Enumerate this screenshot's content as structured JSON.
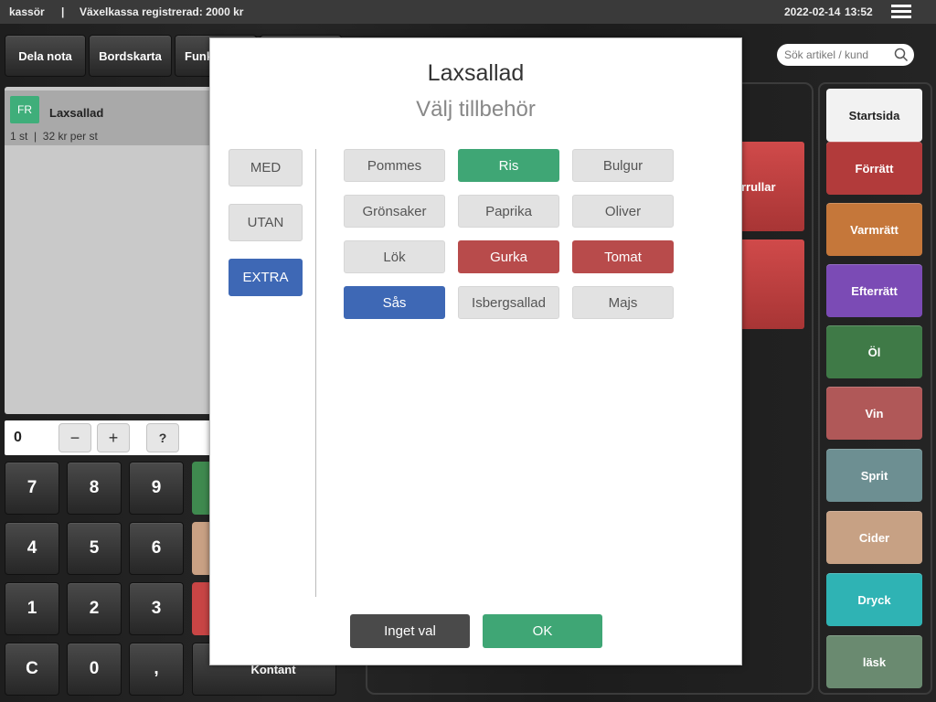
{
  "topbar": {
    "user": "kassör",
    "separator": "|",
    "cash_register": "Växelkassa registrerad:  2000 kr",
    "date": "2022-02-14",
    "time": "13:52"
  },
  "toolbar": {
    "split_bill": "Dela nota",
    "table_map": "Bordskarta",
    "functions": "Funk"
  },
  "search": {
    "placeholder": "Sök artikel / kund"
  },
  "order": {
    "items": [
      {
        "badge": "FR",
        "name": "Laxsallad",
        "detail": "1 st  |  32 kr per st"
      }
    ]
  },
  "qty": {
    "value": "0",
    "minus": "−",
    "plus": "+",
    "help": "?"
  },
  "numpad": {
    "keys": [
      "7",
      "8",
      "9",
      "4",
      "5",
      "6",
      "1",
      "2",
      "3",
      "C",
      "0",
      ","
    ],
    "cash": "Kontant"
  },
  "products": {
    "partial": "rrullar"
  },
  "categories": [
    {
      "label": "Startsida",
      "color": "#f2f2f2"
    },
    {
      "label": "Förrätt",
      "color": "#b23b3b"
    },
    {
      "label": "Varmrätt",
      "color": "#c5773a"
    },
    {
      "label": "Efterrätt",
      "color": "#7b4bb5"
    },
    {
      "label": "Öl",
      "color": "#3f7a47"
    },
    {
      "label": "Vin",
      "color": "#b05858"
    },
    {
      "label": "Sprit",
      "color": "#6d8f92"
    },
    {
      "label": "Cider",
      "color": "#c7a184"
    },
    {
      "label": "Dryck",
      "color": "#2fb3b4"
    },
    {
      "label": "läsk",
      "color": "#6a8a70"
    }
  ],
  "modal": {
    "title": "Laxsallad",
    "subtitle": "Välj tillbehör",
    "tabs": [
      {
        "label": "MED",
        "active": false
      },
      {
        "label": "UTAN",
        "active": false
      },
      {
        "label": "EXTRA",
        "active": true
      }
    ],
    "options": [
      {
        "label": "Pommes",
        "state": "none"
      },
      {
        "label": "Ris",
        "state": "green"
      },
      {
        "label": "Bulgur",
        "state": "none"
      },
      {
        "label": "Grönsaker",
        "state": "none"
      },
      {
        "label": "Paprika",
        "state": "none"
      },
      {
        "label": "Oliver",
        "state": "none"
      },
      {
        "label": "Lök",
        "state": "none"
      },
      {
        "label": "Gurka",
        "state": "red"
      },
      {
        "label": "Tomat",
        "state": "red"
      },
      {
        "label": "Sås",
        "state": "blue"
      },
      {
        "label": "Isbergsallad",
        "state": "none"
      },
      {
        "label": "Majs",
        "state": "none"
      }
    ],
    "no_choice": "Inget val",
    "ok": "OK"
  },
  "colors": {
    "accent_green": "#3fa675",
    "accent_red": "#b84b4b",
    "accent_blue": "#3e68b5"
  }
}
